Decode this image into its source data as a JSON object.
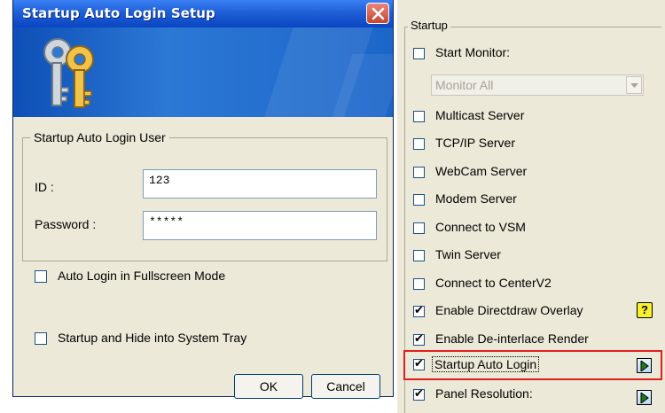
{
  "dialog": {
    "title": "Startup Auto Login Setup",
    "group_title": "Startup Auto Login User",
    "id_label": "ID :",
    "id_value": "123",
    "password_label": "Password :",
    "password_value": "*****",
    "fullscreen_label": "Auto Login in Fullscreen Mode",
    "fullscreen_checked": false,
    "tray_label": "Startup and Hide into System Tray",
    "tray_checked": false,
    "ok_label": "OK",
    "cancel_label": "Cancel"
  },
  "panel": {
    "group_title": "Startup",
    "start_monitor_label": "Start Monitor:",
    "monitor_select_value": "Monitor All",
    "items": [
      {
        "label": "Multicast Server",
        "checked": false
      },
      {
        "label": "TCP/IP Server",
        "checked": false
      },
      {
        "label": "WebCam Server",
        "checked": false
      },
      {
        "label": "Modem Server",
        "checked": false
      },
      {
        "label": "Connect to VSM",
        "checked": false
      },
      {
        "label": "Twin Server",
        "checked": false
      },
      {
        "label": "Connect to CenterV2",
        "checked": false
      },
      {
        "label": "Enable Directdraw Overlay",
        "checked": true
      },
      {
        "label": "Enable De-interlace Render",
        "checked": true
      },
      {
        "label": "Startup Auto Login",
        "checked": true
      },
      {
        "label": "Panel Resolution:",
        "checked": true
      }
    ],
    "help_icon_text": "?",
    "colors": {
      "highlight": "#e02020",
      "help_icon": "#f7f12b",
      "titlebar": "#0a45c2"
    }
  }
}
